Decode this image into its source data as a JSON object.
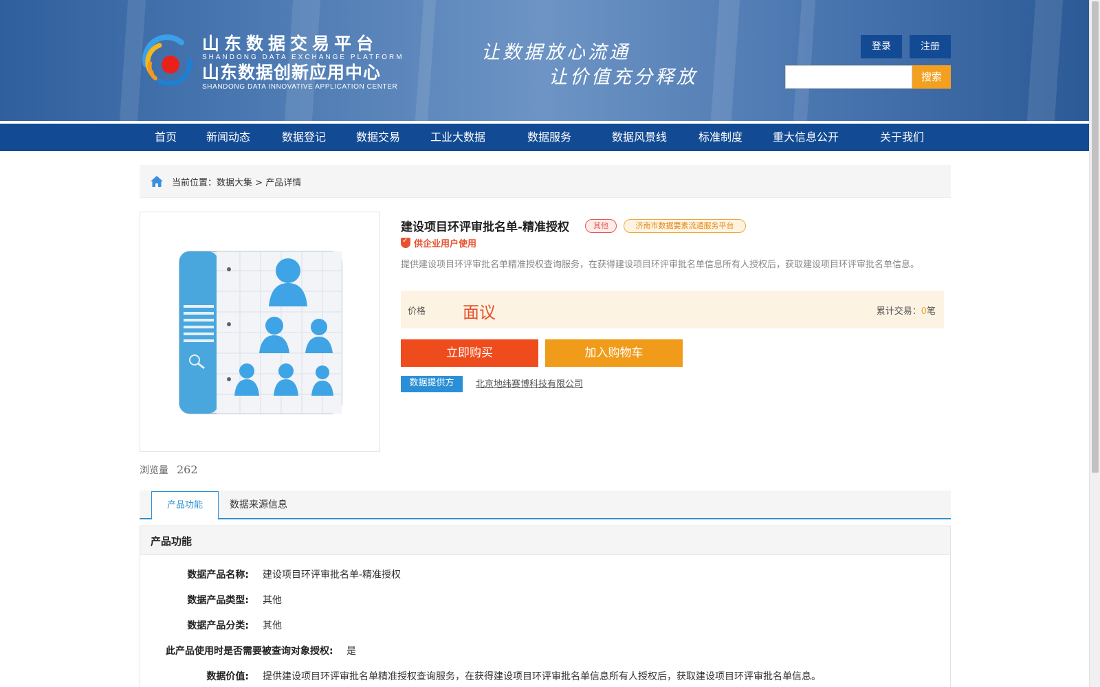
{
  "header": {
    "brand_cn": "山东数据交易平台",
    "brand_en": "SHANDONG DATA EXCHANGE PLATFORM",
    "center_cn": "山东数据创新应用中心",
    "center_en": "SHANDONG DATA INNOVATIVE APPLICATION CENTER",
    "slogan_line1": "让数据放心流通",
    "slogan_line2": "让价值充分释放",
    "login_label": "登录",
    "register_label": "注册",
    "search_placeholder": "",
    "search_label": "搜索",
    "brand_color": "#134a94"
  },
  "nav": {
    "items": [
      "首页",
      "新闻动态",
      "数据登记",
      "数据交易",
      "工业大数据",
      "数据服务",
      "数据风景线",
      "标准制度",
      "重大信息公开",
      "关于我们"
    ]
  },
  "breadcrumb": {
    "prefix": "当前位置：",
    "path": "数据大集",
    "sep": " > ",
    "current": "产品详情"
  },
  "product": {
    "title": "建设项目环评审批名单-精准授权",
    "tag_type": "其他",
    "tag_platform": "济南市数据要素流通服务平台",
    "enterprise_label": "供企业用户使用",
    "description": "提供建设项目环评审批名单精准授权查询服务，在获得建设项目环评审批名单信息所有人授权后，获取建设项目环评审批名单信息。",
    "price_label": "价格",
    "price_value": "面议",
    "trades_label": "累计交易：",
    "trades_count": "0",
    "trades_unit": "笔",
    "buy_label": "立即购买",
    "cart_label": "加入购物车",
    "provider_badge": "数据提供方",
    "provider_name": "北京地纬赛博科技有限公司",
    "views_label": "浏览量",
    "views_count": "262",
    "accent_color": "#ef4c1d",
    "cart_color": "#f09b1a"
  },
  "tabs": {
    "active": "产品功能",
    "other": "数据来源信息"
  },
  "detail": {
    "heading": "产品功能",
    "rows": [
      {
        "k": "数据产品名称:",
        "v": "建设项目环评审批名单-精准授权"
      },
      {
        "k": "数据产品类型:",
        "v": "其他"
      },
      {
        "k": "数据产品分类:",
        "v": "其他"
      },
      {
        "k": "此产品使用时是否需要被查询对象授权:",
        "v": "是"
      },
      {
        "k": "数据价值:",
        "v": "提供建设项目环评审批名单精准授权查询服务，在获得建设项目环评审批名单信息所有人授权后，获取建设项目环评审批名单信息。"
      }
    ]
  }
}
